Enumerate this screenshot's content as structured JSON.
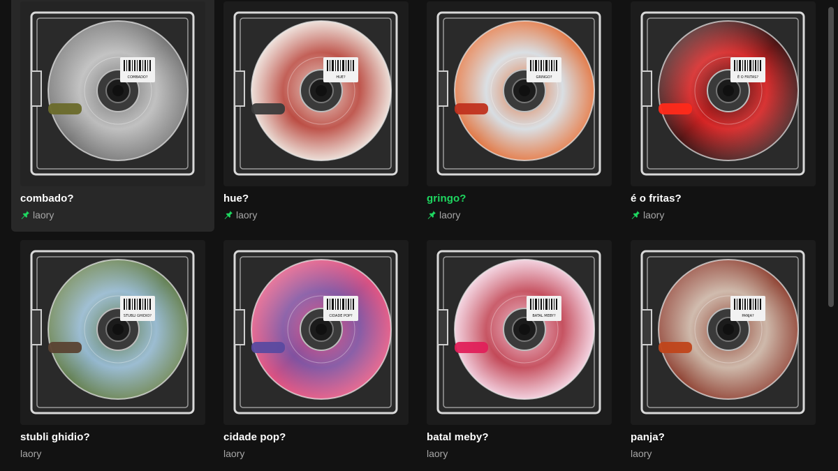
{
  "playlists": [
    {
      "title": "combado?",
      "owner": "laory",
      "pinned": true,
      "active": false,
      "hover": true,
      "disc": {
        "base": "#b9b9b9",
        "accent": "#6f6f6f",
        "tab": "#6a6a2a"
      },
      "label": "COMBADO?"
    },
    {
      "title": "hue?",
      "owner": "laory",
      "pinned": true,
      "active": false,
      "hover": false,
      "disc": {
        "base": "#b8443a",
        "accent": "#e9d8d0",
        "tab": "#3b3b3b"
      },
      "label": "HUE?"
    },
    {
      "title": "gringo?",
      "owner": "laory",
      "pinned": true,
      "active": true,
      "hover": false,
      "disc": {
        "base": "#d5dbe0",
        "accent": "#e0703a",
        "tab": "#c0321e"
      },
      "label": "GRINGO?"
    },
    {
      "title": "é o fritas?",
      "owner": "laory",
      "pinned": true,
      "active": false,
      "hover": false,
      "disc": {
        "base": "#d41a1a",
        "accent": "#3a0a0a",
        "tab": "#ff2a1a"
      },
      "label": "É O FRITAS?"
    },
    {
      "title": "stubli ghidio?",
      "owner": "laory",
      "pinned": false,
      "active": false,
      "hover": false,
      "disc": {
        "base": "#8fb4cc",
        "accent": "#5d7a48",
        "tab": "#5a4232"
      },
      "label": "STUBLI GHIDIO?"
    },
    {
      "title": "cidade pop?",
      "owner": "laory",
      "pinned": false,
      "active": false,
      "hover": false,
      "disc": {
        "base": "#7a4a9c",
        "accent": "#e04a7a",
        "tab": "#5a4aa0"
      },
      "label": "CIDADE POP?"
    },
    {
      "title": "batal meby?",
      "owner": "laory",
      "pinned": false,
      "active": false,
      "hover": false,
      "disc": {
        "base": "#c04050",
        "accent": "#f0c8d8",
        "tab": "#e0205a"
      },
      "label": "BATAL MEBY?"
    },
    {
      "title": "panja?",
      "owner": "laory",
      "pinned": false,
      "active": false,
      "hover": false,
      "disc": {
        "base": "#c8b0a0",
        "accent": "#8a3a2a",
        "tab": "#c0441a"
      },
      "label": "PANJA?"
    }
  ],
  "colors": {
    "background": "#121212",
    "active": "#1ed760",
    "pin": "#1ed760",
    "subtext": "#a7a7a7"
  },
  "icons": {
    "pin": "pin-icon"
  }
}
